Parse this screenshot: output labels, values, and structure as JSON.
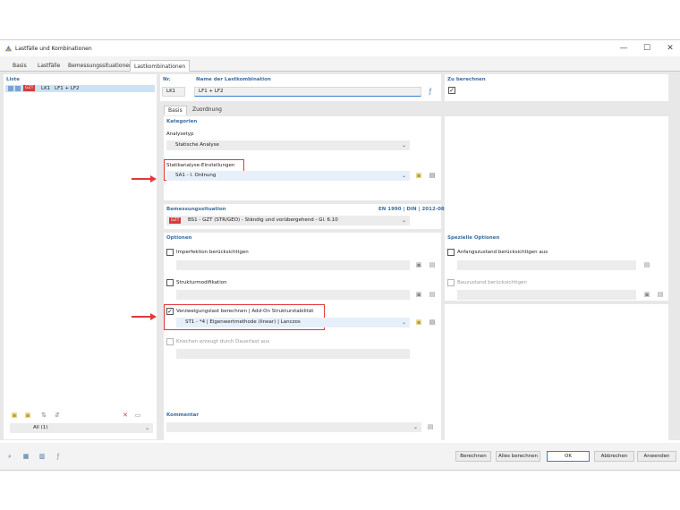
{
  "window": {
    "title": "Lastfälle und Kombinationen",
    "minimize": "—",
    "maximize": "☐",
    "close": "✕"
  },
  "tabs": [
    "Basis",
    "Lastfälle",
    "Bemessungssituationen",
    "Lastkombinationen"
  ],
  "left_panel": {
    "header": "Liste",
    "item": {
      "badge": "GZT",
      "id": "LK1",
      "text": "LF1 + LF2"
    },
    "filter": "All (1)"
  },
  "top": {
    "nr_label": "Nr.",
    "nr_value": "LK1",
    "name_label": "Name der Lastkombination",
    "name_value": "LF1 + LF2",
    "calc_label": "Zu berechnen",
    "calc_checked": "✓"
  },
  "subtabs": [
    "Basis",
    "Zuordnung"
  ],
  "kategorien": {
    "header": "Kategorien",
    "analysetyp_label": "Analysetyp",
    "analysetyp_value": "Statische Analyse",
    "statik_label": "Statikanalyse-Einstellungen",
    "statik_value": "SA1 - I. Ordnung"
  },
  "bemessung": {
    "header": "Bemessungssituation",
    "norm": "EN 1990 | DIN | 2012-08",
    "badge": "GZT",
    "value": "BS1 - GZT (STR/GEO) - Ständig und vorübergehend - Gl. 6.10"
  },
  "optionen": {
    "header": "Optionen",
    "imperfektion": "Imperfektion berücksichtigen",
    "struktur": "Strukturmodifikation",
    "verzweigung": "Verzweigungslast berechnen | Add-On Strukturstabilität",
    "verzweigung_checked": "✓",
    "verzweigung_value": "ST1 - *4 | Eigenwertmethode (linear) | Lanczos",
    "kriechen": "Kriechen erzeugt durch Dauerlast aus"
  },
  "spezielle": {
    "header": "Spezielle Optionen",
    "anfangszustand": "Anfangszustand berücksichtigen aus",
    "bauzustand": "Bauzustand berücksichtigen"
  },
  "kommentar": {
    "header": "Kommentar"
  },
  "footer_buttons": {
    "berechnen": "Berechnen",
    "alles": "Alles berechnen",
    "ok": "OK",
    "abbrechen": "Abbrechen",
    "anwenden": "Anwenden"
  },
  "colors": {
    "accent": "#3c6ea0",
    "highlight": "#e03a3a",
    "badge": "#d43c3c"
  }
}
